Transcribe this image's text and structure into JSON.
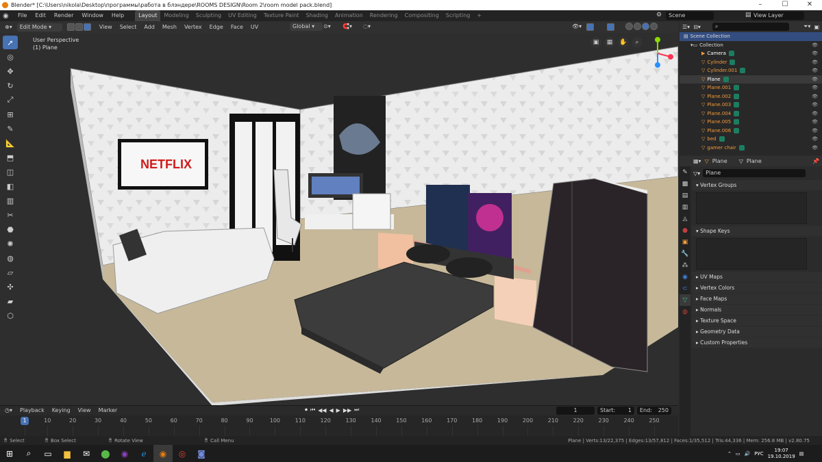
{
  "window": {
    "title": "Blender* [C:\\Users\\nikola\\Desktop\\программы\\работа в блэндере\\ROOMS DESIGN\\Room 2\\room model pack.blend]",
    "controls": [
      "–",
      "☐",
      "✕"
    ]
  },
  "topbar": {
    "menus": [
      "File",
      "Edit",
      "Render",
      "Window",
      "Help"
    ],
    "workspaces": [
      "Layout",
      "Modeling",
      "Sculpting",
      "UV Editing",
      "Texture Paint",
      "Shading",
      "Animation",
      "Rendering",
      "Compositing",
      "Scripting"
    ],
    "active_workspace": "Layout",
    "add": "+",
    "scene": "Scene",
    "view_layer": "View Layer"
  },
  "viewport_header": {
    "mode": "Edit Mode",
    "menus": [
      "View",
      "Select",
      "Add",
      "Mesh",
      "Vertex",
      "Edge",
      "Face",
      "UV"
    ],
    "orientation": "Global"
  },
  "viewport": {
    "perspective": "User Perspective",
    "object": "(1) Plane",
    "tv_text": "NETFLIX"
  },
  "timeline": {
    "menus": [
      "Playback",
      "Keying",
      "View",
      "Marker"
    ],
    "current_frame": "1",
    "start_label": "Start:",
    "start": "1",
    "end_label": "End:",
    "end": "250",
    "ticks": [
      "1",
      "10",
      "20",
      "30",
      "40",
      "50",
      "60",
      "70",
      "80",
      "90",
      "100",
      "110",
      "120",
      "130",
      "140",
      "150",
      "160",
      "170",
      "180",
      "190",
      "200",
      "210",
      "220",
      "230",
      "240",
      "250"
    ]
  },
  "status": {
    "select": "Select",
    "box_select": "Box Select",
    "rotate": "Rotate View",
    "call_menu": "Call Menu",
    "stats": "Plane | Verts:13/22,375 | Edges:13/57,812 | Faces:1/35,512 | Tris:44,336 | Mem: 256.8 MB | v2.80.75"
  },
  "taskbar": {
    "lang": "РУС",
    "time": "19:07",
    "date": "19.10.2019"
  },
  "outliner": {
    "root": "Scene Collection",
    "collection": "Collection",
    "items": [
      "Camera",
      "Cylinder",
      "Cylinder.001",
      "Plane",
      "Plane.001",
      "Plane.002",
      "Plane.003",
      "Plane.004",
      "Plane.005",
      "Plane.006",
      "bed",
      "gamer chair"
    ]
  },
  "properties": {
    "breadcrumb_obj": "Plane",
    "breadcrumb_data": "Plane",
    "mesh_name": "Plane",
    "panels_open": [
      "Vertex Groups",
      "Shape Keys"
    ],
    "panels_closed": [
      "UV Maps",
      "Vertex Colors",
      "Face Maps",
      "Normals",
      "Texture Space",
      "Geometry Data",
      "Custom Properties"
    ]
  }
}
